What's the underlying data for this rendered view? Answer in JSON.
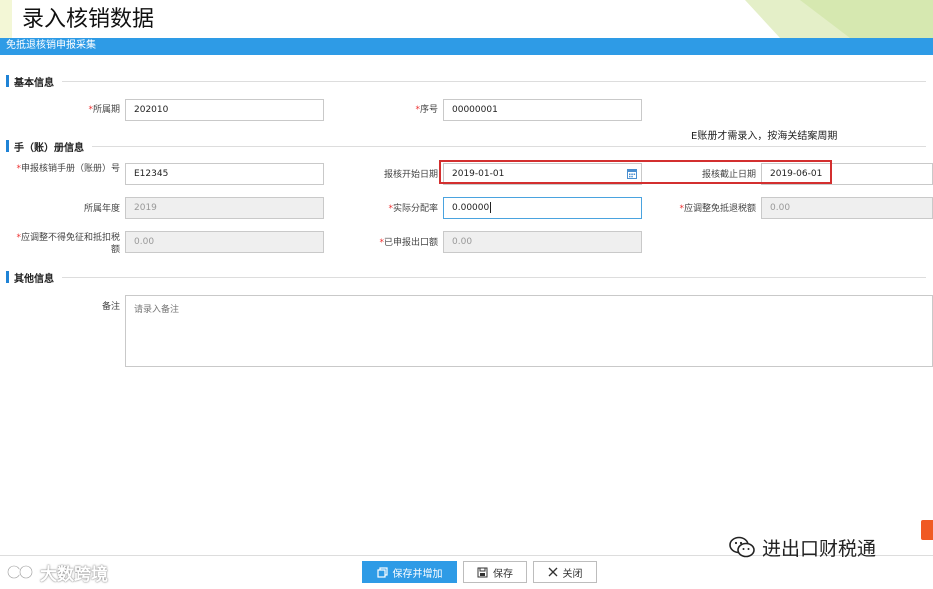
{
  "slide_title": "录入核销数据",
  "form_title": "免抵退核销申报采集",
  "sections": {
    "basic": "基本信息",
    "manual": "手（账）册信息",
    "other": "其他信息"
  },
  "basic": {
    "period_label": "所属期",
    "period_value": "202010",
    "seq_label": "序号",
    "seq_value": "00000001"
  },
  "annotation_note": "E账册才需录入，按海关结案周期",
  "manual": {
    "handbook_label": "申报核销手册（账册）号",
    "handbook_value": "E12345",
    "start_label": "报核开始日期",
    "start_value": "2019-01-01",
    "end_label": "报核截止日期",
    "end_value": "2019-06-01",
    "year_label": "所属年度",
    "year_value": "2019",
    "ratio_label": "实际分配率",
    "ratio_value": "0.00000",
    "adjust_refund_label": "应调整免抵退税额",
    "adjust_refund_value": "0.00",
    "adjust_nondeduct_label": "应调整不得免征和抵扣税额",
    "adjust_nondeduct_value": "0.00",
    "declared_export_label": "已申报出口额",
    "declared_export_value": "0.00"
  },
  "other": {
    "remark_label": "备注",
    "remark_placeholder": "请录入备注"
  },
  "buttons": {
    "save_add": "保存并增加",
    "save": "保存",
    "close": "关闭"
  },
  "watermark_left": "大数跨境",
  "watermark_right": "进出口财税通",
  "colors": {
    "header_blue": "#2e9be6",
    "required_red": "#e33333",
    "highlight_red": "#d32f2f"
  }
}
